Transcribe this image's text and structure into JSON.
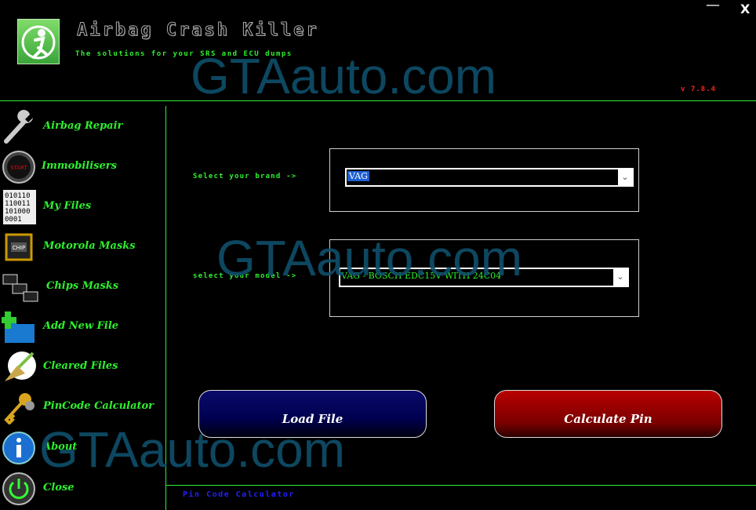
{
  "header": {
    "title": "Airbag Crash Killer",
    "subtitle": "The solutions for your SRS and ECU dumps",
    "version": "v 7.8.4",
    "minimize": "—",
    "close": "X"
  },
  "sidebar": {
    "items": [
      {
        "label": "Airbag Repair",
        "icon": "wrench-icon"
      },
      {
        "label": "Immobilisers",
        "icon": "start-button-icon"
      },
      {
        "label": "My Files",
        "icon": "binary-file-icon"
      },
      {
        "label": "Motorola Masks",
        "icon": "cpu-chip-icon"
      },
      {
        "label": "Chips Masks",
        "icon": "chips-icon"
      },
      {
        "label": "Add New File",
        "icon": "add-folder-icon"
      },
      {
        "label": "Cleared Files",
        "icon": "broom-icon"
      },
      {
        "label": "PinCode Calculator",
        "icon": "keys-icon"
      },
      {
        "label": "About",
        "icon": "info-icon"
      },
      {
        "label": "Close",
        "icon": "power-icon"
      }
    ]
  },
  "main": {
    "brand_label": "Select your brand ->",
    "brand_value": "VAG",
    "model_label": "select your model ->",
    "model_value": "VAG - BOSCH EDC15V WITH 24C04",
    "load_button": "Load File",
    "calculate_button": "Calculate Pin",
    "footer": "Pin Code Calculator"
  },
  "watermarks": [
    "GTAauto.com",
    "GTAauto.com",
    "GTAauto.com"
  ],
  "colors": {
    "accent": "#2ef02e",
    "background": "#000000",
    "version": "#ff2020",
    "footer": "#2020ff"
  }
}
